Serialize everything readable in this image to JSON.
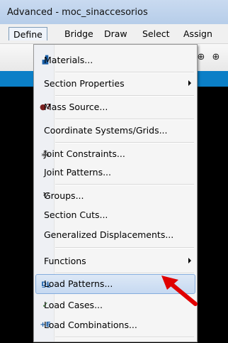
{
  "window": {
    "title": "Advanced  - moc_sinaccesorios"
  },
  "menubar": {
    "items": [
      {
        "label": "Define",
        "active": true
      },
      {
        "label": "Bridge",
        "active": false
      },
      {
        "label": "Draw",
        "active": false
      },
      {
        "label": "Select",
        "active": false
      },
      {
        "label": "Assign",
        "active": false
      }
    ]
  },
  "toolbar": {
    "icons": [
      "zoom-rotate-icon",
      "zoom-in-icon"
    ]
  },
  "dropdown": {
    "items": [
      {
        "label": "Materials...",
        "icon": "materials-icon",
        "submenu": false
      },
      {
        "label": "Section Properties",
        "icon": "",
        "submenu": true
      },
      {
        "label": "Mass Source...",
        "icon": "mass-source-icon",
        "submenu": false
      },
      {
        "label": "Coordinate Systems/Grids...",
        "icon": "",
        "submenu": false
      },
      {
        "label": "Joint Constraints...",
        "icon": "joint-constraints-icon",
        "submenu": false
      },
      {
        "label": "Joint Patterns...",
        "icon": "",
        "submenu": false
      },
      {
        "label": "Groups...",
        "icon": "groups-icon",
        "submenu": false
      },
      {
        "label": "Section Cuts...",
        "icon": "",
        "submenu": false
      },
      {
        "label": "Generalized Displacements...",
        "icon": "",
        "submenu": false
      },
      {
        "label": "Functions",
        "icon": "",
        "submenu": true
      },
      {
        "label": "Load Patterns...",
        "icon": "load-patterns-icon",
        "submenu": false,
        "highlighted": true
      },
      {
        "label": "Load Cases...",
        "icon": "load-cases-icon",
        "submenu": false
      },
      {
        "label": "Load Combinations...",
        "icon": "load-combinations-icon",
        "submenu": false
      }
    ]
  },
  "colors": {
    "accent": "#0b7fc7",
    "highlight": "#c6d9f1",
    "arrow": "#e00000"
  }
}
